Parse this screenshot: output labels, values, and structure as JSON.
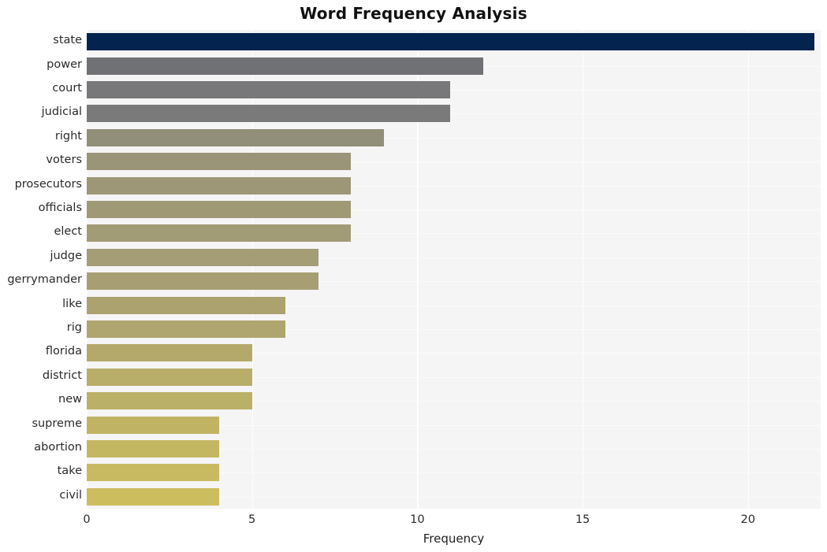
{
  "chart_data": {
    "type": "bar",
    "orientation": "horizontal",
    "title": "Word Frequency Analysis",
    "xlabel": "Frequency",
    "ylabel": "",
    "categories": [
      "state",
      "power",
      "court",
      "judicial",
      "right",
      "voters",
      "prosecutors",
      "officials",
      "elect",
      "judge",
      "gerrymander",
      "like",
      "rig",
      "florida",
      "district",
      "new",
      "supreme",
      "abortion",
      "take",
      "civil"
    ],
    "values": [
      22,
      12,
      11,
      11,
      9,
      8,
      8,
      8,
      8,
      7,
      7,
      6,
      6,
      5,
      5,
      5,
      4,
      4,
      4,
      4
    ],
    "xlim": [
      0,
      22.2
    ],
    "xticks": [
      0,
      5,
      10,
      15,
      20
    ],
    "xtick_labels": [
      "0",
      "5",
      "10",
      "15",
      "20"
    ],
    "grid": true,
    "grid_axis": "both",
    "legend": "none",
    "bar_colors": [
      "#04234f",
      "#707174",
      "#78787a",
      "#7b7a7b",
      "#918e79",
      "#9a9478",
      "#9d9777",
      "#9f9976",
      "#a19b76",
      "#a49d75",
      "#a79f73",
      "#aca26f",
      "#afa56e",
      "#b4a96b",
      "#b8ad69",
      "#bbb067",
      "#c0b464",
      "#c4b762",
      "#c8ba60",
      "#ccbd5f"
    ],
    "plot_background": "#f5f5f6",
    "grid_color": "#ffffff",
    "figure_background": "#ffffff"
  }
}
